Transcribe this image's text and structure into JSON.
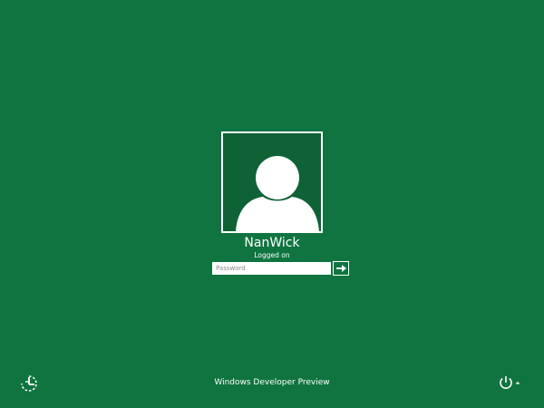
{
  "user": {
    "name": "NanWick",
    "status": "Logged on"
  },
  "password": {
    "placeholder": "Password",
    "value": ""
  },
  "submit": {
    "label": "Submit",
    "icon": "arrow-right-icon"
  },
  "footer": {
    "brand": "Windows Developer Preview"
  },
  "icons": {
    "ease_of_access": "ease-of-access-icon",
    "power": "power-icon",
    "power_menu": "caret-up-icon",
    "avatar": "user-silhouette-icon"
  },
  "colors": {
    "background": "#0f7440",
    "avatar_tile": "#0e6235",
    "foreground": "#ffffff"
  }
}
